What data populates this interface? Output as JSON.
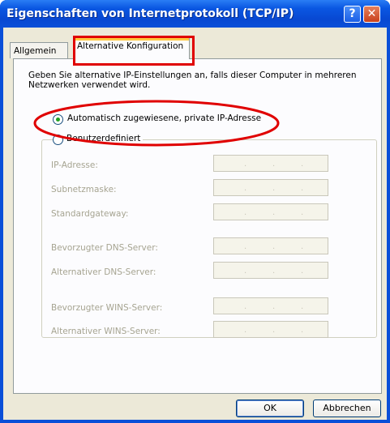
{
  "window": {
    "title": "Eigenschaften von Internetprotokoll (TCP/IP)",
    "help_glyph": "?",
    "close_glyph": "✕"
  },
  "tabs": [
    {
      "label": "Allgemein",
      "selected": false
    },
    {
      "label": "Alternative Konfiguration",
      "selected": true
    }
  ],
  "description": "Geben Sie alternative IP-Einstellungen an, falls dieser Computer in mehreren Netzwerken verwendet wird.",
  "options": {
    "auto": {
      "label": "Automatisch zugewiesene, private IP-Adresse",
      "checked": true
    },
    "manual": {
      "label": "Benutzerdefiniert",
      "checked": false
    }
  },
  "fields": [
    {
      "label": "IP-Adresse:",
      "enabled": false
    },
    {
      "label": "Subnetzmaske:",
      "enabled": false
    },
    {
      "label": "Standardgateway:",
      "enabled": false
    },
    {
      "label": "Bevorzugter DNS-Server:",
      "enabled": false
    },
    {
      "label": "Alternativer DNS-Server:",
      "enabled": false
    },
    {
      "label": "Bevorzugter WINS-Server:",
      "enabled": false
    },
    {
      "label": "Alternativer WINS-Server:",
      "enabled": false
    }
  ],
  "buttons": {
    "ok": "OK",
    "cancel": "Abbrechen"
  },
  "colors": {
    "annotation": "#e00000",
    "title_bar": "#0a4fd8",
    "dialog_bg": "#ece9d8"
  }
}
